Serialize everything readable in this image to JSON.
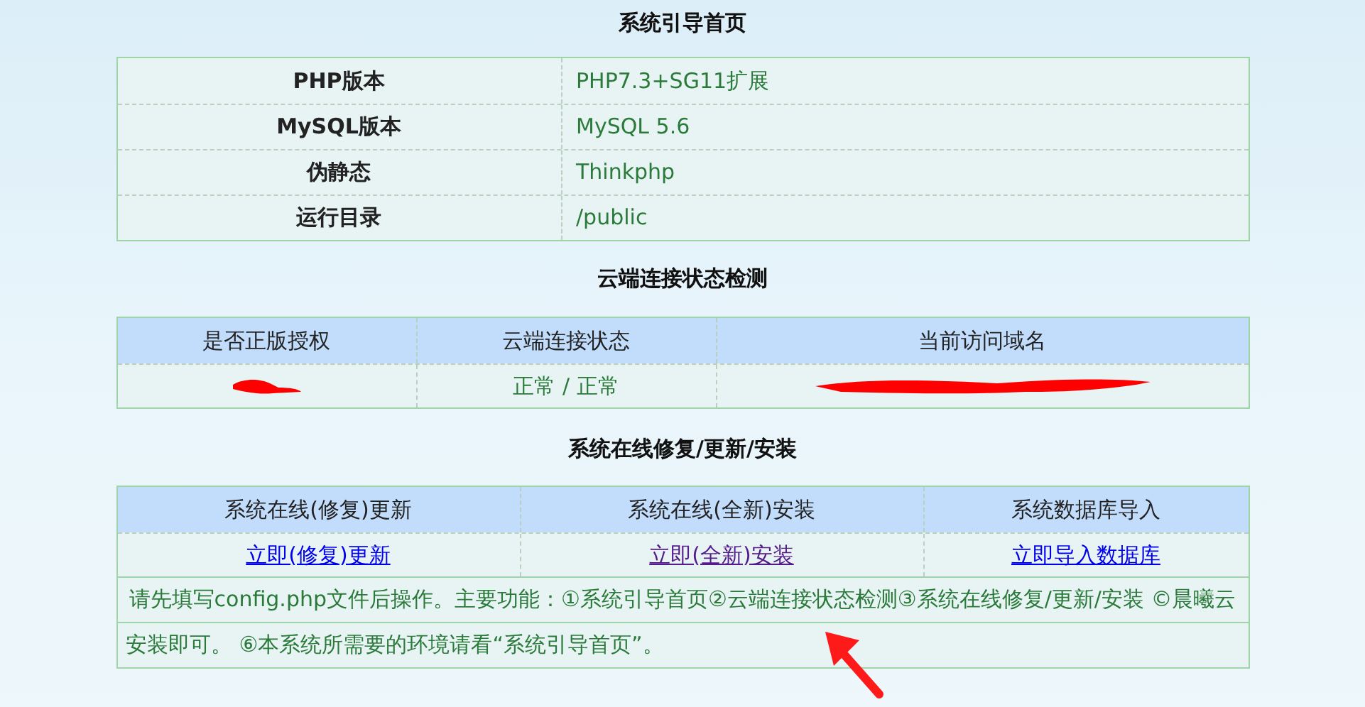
{
  "env_section": {
    "title": "系统引导首页",
    "rows": [
      {
        "label": "PHP版本",
        "value": "PHP7.3+SG11扩展"
      },
      {
        "label": "MySQL版本",
        "value": "MySQL 5.6"
      },
      {
        "label": "伪静态",
        "value": "Thinkphp"
      },
      {
        "label": "运行目录",
        "value": "/public"
      }
    ]
  },
  "cloud_section": {
    "title": "云端连接状态检测",
    "columns": [
      "是否正版授权",
      "云端连接状态",
      "当前访问域名"
    ],
    "cells": [
      {
        "kind": "redacted"
      },
      {
        "kind": "text",
        "text": "正常 / 正常"
      },
      {
        "kind": "redacted"
      }
    ]
  },
  "install_section": {
    "title": "系统在线修复/更新/安装",
    "columns": [
      "系统在线(修复)更新",
      "系统在线(全新)安装",
      "系统数据库导入"
    ],
    "links": [
      {
        "text": "立即(修复)更新",
        "visited": false
      },
      {
        "text": "立即(全新)安装",
        "visited": true
      },
      {
        "text": "立即导入数据库",
        "visited": false
      }
    ],
    "notice": "请先填写config.php文件后操作。主要功能：①系统引导首页②云端连接状态检测③系统在线修复/更新/安装 ©晨曦云",
    "marquee": "安装即可。 ⑥本系统所需要的环境请看“系统引导首页”。"
  }
}
